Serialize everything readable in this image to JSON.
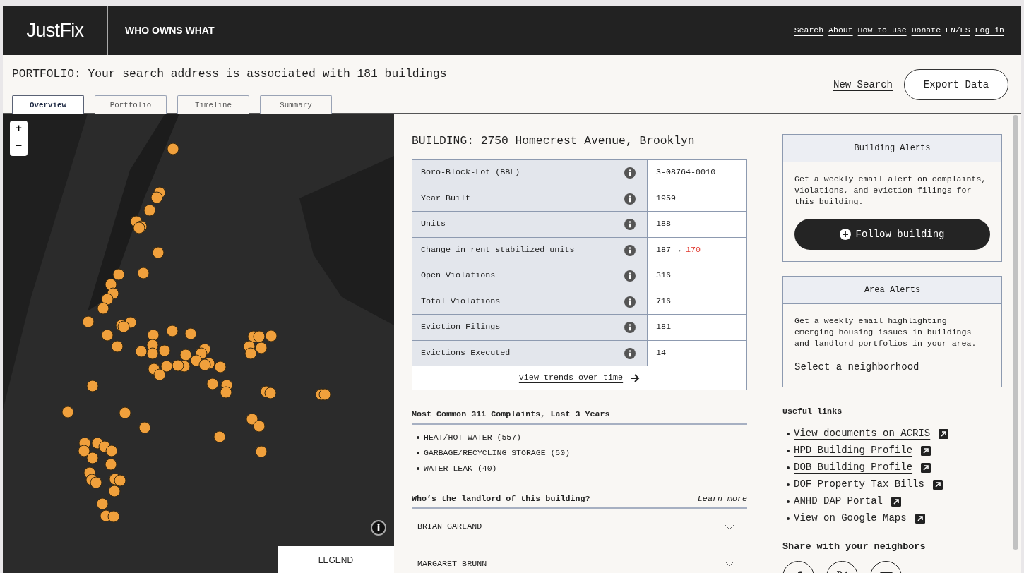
{
  "header": {
    "logo": "JustFix",
    "product": "WHO OWNS WHAT",
    "nav": [
      {
        "label": "Search"
      },
      {
        "label": "About"
      },
      {
        "label": "How to use"
      },
      {
        "label": "Donate"
      }
    ],
    "language": {
      "current": "EN",
      "separator": "/",
      "other": "ES"
    },
    "login": "Log in"
  },
  "portfolio": {
    "prefix": "PORTFOLIO: Your search address is associated with",
    "count": "181",
    "suffix": "buildings",
    "new_search": "New Search",
    "export": "Export Data"
  },
  "tabs": [
    {
      "label": "Overview",
      "selected": true
    },
    {
      "label": "Portfolio",
      "selected": false
    },
    {
      "label": "Timeline",
      "selected": false
    },
    {
      "label": "Summary",
      "selected": false
    }
  ],
  "map": {
    "zoom_in": "+",
    "zoom_out": "−",
    "legend": "LEGEND"
  },
  "building": {
    "title": "BUILDING: 2750 Homecrest Avenue, Brooklyn",
    "rows": [
      {
        "label": "Boro-Block-Lot (BBL)",
        "value": "3-08764-0010"
      },
      {
        "label": "Year Built",
        "value": "1959"
      },
      {
        "label": "Units",
        "value": "188"
      },
      {
        "label": "Change in rent stabilized units",
        "value": "187",
        "arrow": "→",
        "new_value": "170"
      },
      {
        "label": "Open Violations",
        "value": "316"
      },
      {
        "label": "Total Violations",
        "value": "716"
      },
      {
        "label": "Eviction Filings",
        "value": "181"
      },
      {
        "label": "Evictions Executed",
        "value": "14"
      }
    ],
    "trends_link": "View trends over time"
  },
  "complaints": {
    "title": "Most Common 311 Complaints, Last 3 Years",
    "items": [
      "HEAT/HOT WATER (557)",
      "GARBAGE/RECYCLING STORAGE (50)",
      "WATER LEAK (40)"
    ]
  },
  "landlord": {
    "title": "Who’s the landlord of this building?",
    "learn_more": "Learn more",
    "people": [
      {
        "name": "BRIAN GARLAND",
        "expanded": false
      },
      {
        "name": "MARGARET BRUNN",
        "expanded": false
      }
    ]
  },
  "building_alerts": {
    "title": "Building Alerts",
    "text": "Get a weekly email alert on complaints, violations, and eviction filings for this building.",
    "button": "Follow building"
  },
  "area_alerts": {
    "title": "Area Alerts",
    "text": "Get a weekly email highlighting emerging housing issues in buildings and landlord portfolios in your area.",
    "link": "Select a neighborhood"
  },
  "useful_links": {
    "title": "Useful links",
    "links": [
      "View documents on ACRIS",
      "HPD Building Profile",
      "DOB Building Profile",
      "DOF Property Tax Bills",
      "ANHD DAP Portal",
      "View on Google Maps"
    ]
  },
  "share": {
    "title": "Share with your neighbors",
    "buttons": [
      {
        "kind": "facebook"
      },
      {
        "kind": "x"
      },
      {
        "kind": "email"
      }
    ]
  }
}
